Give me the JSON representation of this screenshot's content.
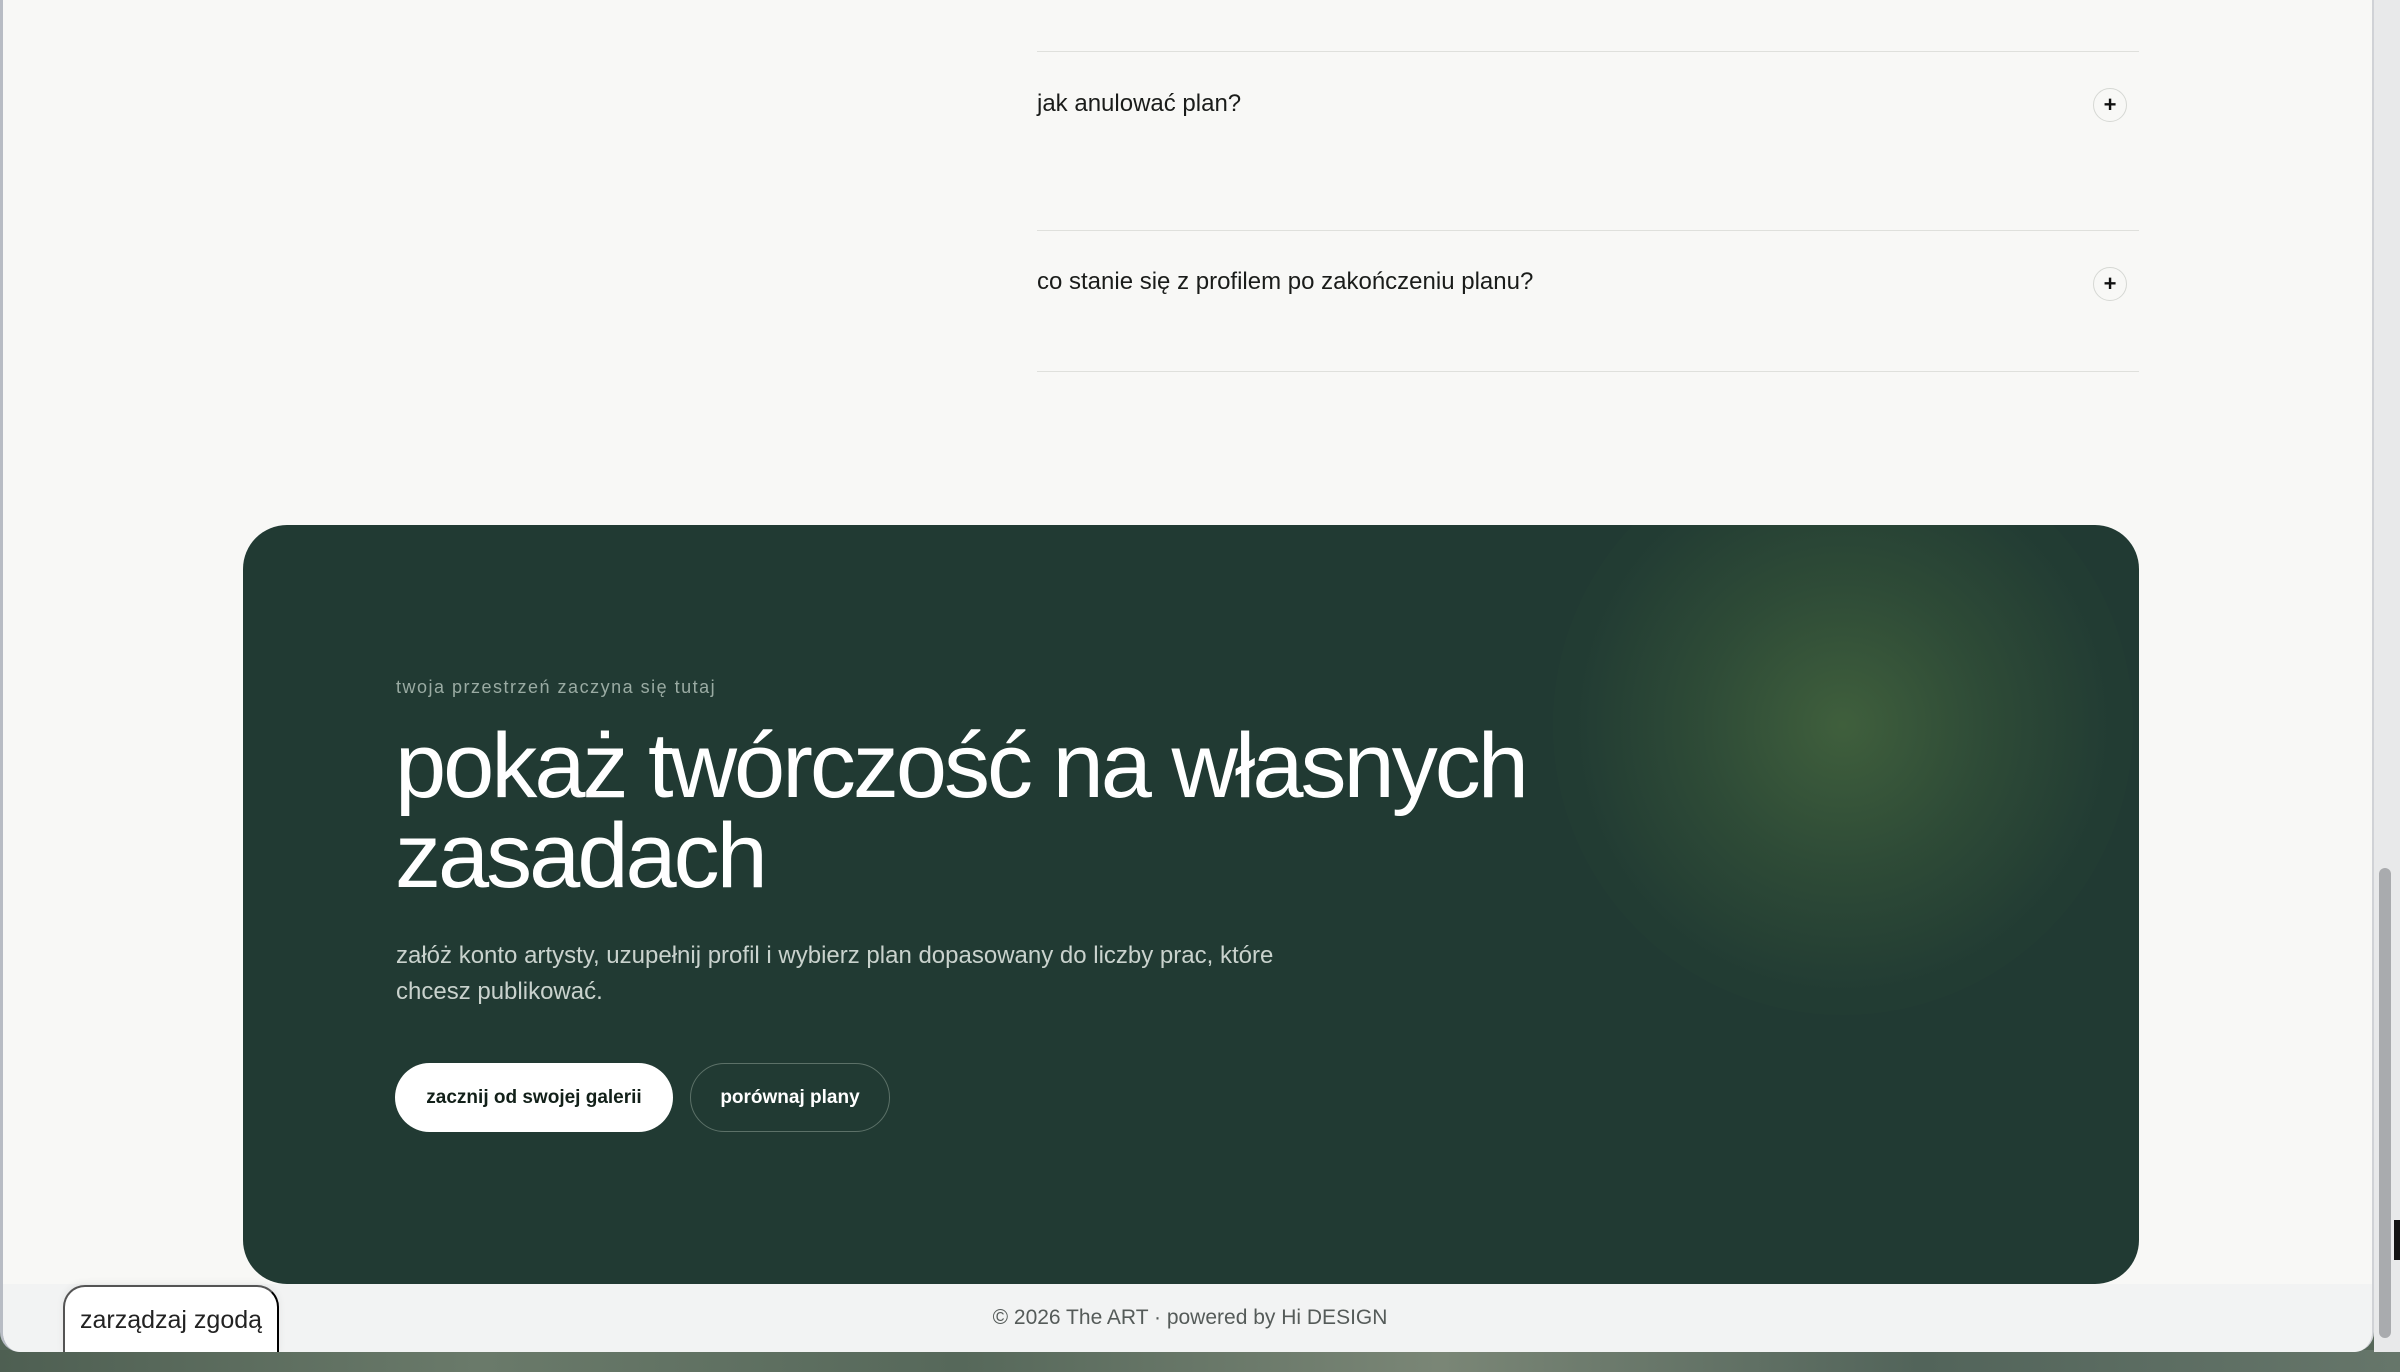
{
  "faq": {
    "items": [
      {
        "question": "jak anulować plan?",
        "toggle": "+"
      },
      {
        "question": "co stanie się z profilem po zakończeniu planu?",
        "toggle": "+"
      }
    ]
  },
  "cta": {
    "eyebrow": "twoja przestrzeń zaczyna się tutaj",
    "title": "pokaż twórczość na własnych zasadach",
    "description": "załóż konto artysty, uzupełnij profil i wybierz plan dopasowany do liczby prac, które chcesz publikować.",
    "primary_button": "zacznij od swojej galerii",
    "secondary_button": "porównaj plany"
  },
  "footer": {
    "copyright": "© 2026 The ART · powered by Hi DESIGN"
  },
  "consent": {
    "label": "zarządzaj zgodą"
  },
  "colors": {
    "cta_bg": "#213a33",
    "page_bg": "#f8f8f6",
    "glow": "#52764a"
  },
  "icons": {
    "faq_toggle": "plus-icon"
  }
}
